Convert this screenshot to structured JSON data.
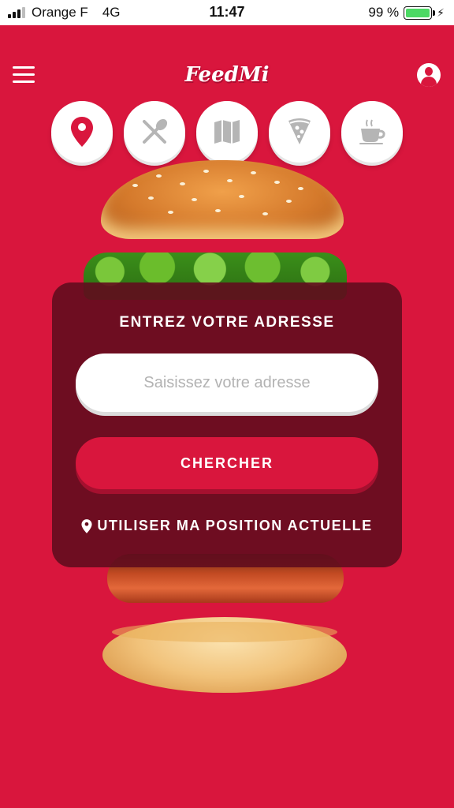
{
  "status_bar": {
    "carrier": "Orange F",
    "network": "4G",
    "time": "11:47",
    "battery": "99 %",
    "battery_level": 0.99,
    "charging_icon": "bolt-icon"
  },
  "header": {
    "logo_text": "FeedMi",
    "menu_icon": "hamburger-menu-icon",
    "profile_icon": "user-profile-icon"
  },
  "categories": [
    {
      "id": "location",
      "icon": "location-pin-icon",
      "active": true
    },
    {
      "id": "restaurant",
      "icon": "fork-spoon-icon",
      "active": false
    },
    {
      "id": "map",
      "icon": "map-icon",
      "active": false
    },
    {
      "id": "pizza",
      "icon": "pizza-slice-icon",
      "active": false
    },
    {
      "id": "coffee",
      "icon": "coffee-cup-icon",
      "active": false
    }
  ],
  "address_card": {
    "title": "ENTREZ VOTRE ADRESSE",
    "input_placeholder": "Saisissez votre adresse",
    "input_value": "",
    "search_button": "CHERCHER",
    "use_location": "UTILISER MA POSITION ACTUELLE"
  },
  "colors": {
    "brand_red": "#d9163d",
    "card_overlay": "#620c1e",
    "icon_gray": "#b5b5b5",
    "white": "#ffffff"
  }
}
